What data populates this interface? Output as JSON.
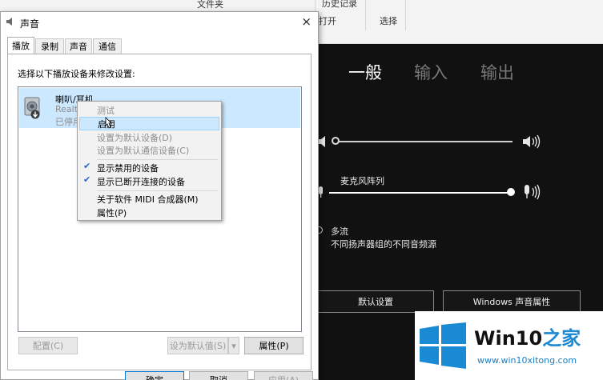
{
  "background_ribbon": {
    "file_menu_label": "文件夹",
    "history_label": "历史记录",
    "open_label": "打开",
    "select_label": "选择"
  },
  "dialog": {
    "title": "声音",
    "close_glyph": "×",
    "tabs": [
      {
        "label": "播放",
        "selected": true
      },
      {
        "label": "录制",
        "selected": false
      },
      {
        "label": "声音",
        "selected": false
      },
      {
        "label": "通信",
        "selected": false
      }
    ],
    "instruction": "选择以下播放设备来修改设置:",
    "device": {
      "name": "喇叭/耳机",
      "driver_partial": "Realte",
      "status_partial": "已停用"
    },
    "page_buttons": {
      "configure": "配置(C)",
      "set_default": "设为默认值(S)",
      "dropdown_glyph": "▾",
      "properties": "属性(P)"
    },
    "bottom_buttons": {
      "ok": "确定",
      "cancel": "取消",
      "apply": "应用(A)"
    }
  },
  "context_menu": {
    "items": [
      {
        "label": "测试",
        "disabled": true,
        "checked": false,
        "highlighted": false
      },
      {
        "label": "启用",
        "disabled": false,
        "checked": false,
        "highlighted": true
      },
      {
        "label": "设置为默认设备(D)",
        "disabled": true,
        "checked": false,
        "highlighted": false
      },
      {
        "label": "设置为默认通信设备(C)",
        "disabled": true,
        "checked": false,
        "highlighted": false
      },
      {
        "label": "显示禁用的设备",
        "disabled": false,
        "checked": true,
        "highlighted": false
      },
      {
        "label": "显示已断开连接的设备",
        "disabled": false,
        "checked": true,
        "highlighted": false
      },
      {
        "label": "关于软件 MIDI 合成器(M)",
        "disabled": false,
        "checked": false,
        "highlighted": false
      },
      {
        "label": "属性(P)",
        "disabled": false,
        "checked": false,
        "highlighted": false
      }
    ],
    "check_glyph": "✔"
  },
  "audio_panel": {
    "tabs": [
      "一般",
      "输入",
      "输出"
    ],
    "active_tab": "一般",
    "output_volume_level": 0.0,
    "mic_label": "麦克风阵列",
    "mic_volume_level": 1.0,
    "multistream_label": "多流",
    "multistream_desc": "不同扬声器组的不同音频源",
    "default_settings_button": "默认设置",
    "windows_sound_props_button": "Windows 声音属性"
  },
  "watermark": {
    "brand_main": "Win10",
    "brand_cn": "之家",
    "url": "www.win10xitong.com"
  },
  "colors": {
    "selection": "#cce8ff",
    "dark_panel": "#111111",
    "win_blue": "#1a8ad4",
    "watermark_url": "#1a7fc4"
  }
}
